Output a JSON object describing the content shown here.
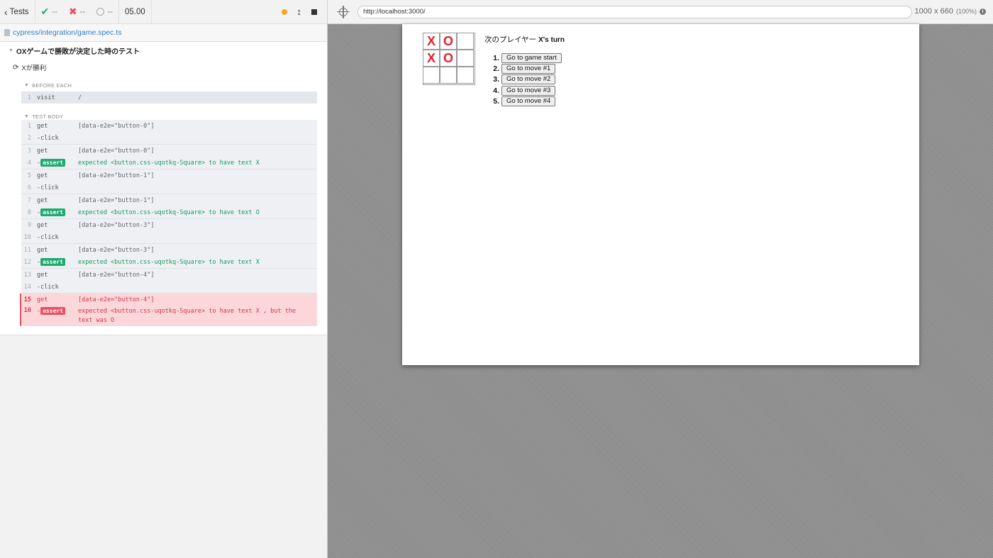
{
  "reporter": {
    "back_label": "Tests",
    "passed": "--",
    "failed": "--",
    "pending": "--",
    "duration": "05.00",
    "spec_path": "cypress/integration/game.spec.ts",
    "suite_title": "OXゲームで勝敗が決定した時のテスト",
    "test_title": "Xが勝利",
    "before_each_label": "BEFORE EACH",
    "test_body_label": "TEST BODY",
    "visit": {
      "num": "1",
      "name": "visit",
      "msg": "/"
    },
    "commands": [
      {
        "num": "1",
        "name": "get",
        "msg": "[data-e2e=\"button-0\"]"
      },
      {
        "num": "2",
        "name": "-click",
        "msg": ""
      },
      {
        "num": "3",
        "name": "get",
        "msg": "[data-e2e=\"button-0\"]"
      },
      {
        "num": "4",
        "name": "assert",
        "msg": "expected  <button.css-uqotkq-Square>  to have text  X"
      },
      {
        "num": "5",
        "name": "get",
        "msg": "[data-e2e=\"button-1\"]"
      },
      {
        "num": "6",
        "name": "-click",
        "msg": ""
      },
      {
        "num": "7",
        "name": "get",
        "msg": "[data-e2e=\"button-1\"]"
      },
      {
        "num": "8",
        "name": "assert",
        "msg": "expected  <button.css-uqotkq-Square>  to have text  O"
      },
      {
        "num": "9",
        "name": "get",
        "msg": "[data-e2e=\"button-3\"]"
      },
      {
        "num": "10",
        "name": "-click",
        "msg": ""
      },
      {
        "num": "11",
        "name": "get",
        "msg": "[data-e2e=\"button-3\"]"
      },
      {
        "num": "12",
        "name": "assert",
        "msg": "expected  <button.css-uqotkq-Square>  to have text  X"
      },
      {
        "num": "13",
        "name": "get",
        "msg": "[data-e2e=\"button-4\"]"
      },
      {
        "num": "14",
        "name": "-click",
        "msg": ""
      }
    ],
    "failed_commands": [
      {
        "num": "15",
        "name": "get",
        "msg": "[data-e2e=\"button-4\"]"
      },
      {
        "num": "16",
        "name": "assert",
        "msg": "expected  <button.css-uqotkq-Square>  to have text  X , but the text was  O"
      }
    ],
    "assert_badge": "assert"
  },
  "aut": {
    "url": "http://localhost:3000/",
    "viewport": "1000 x 660",
    "viewport_pct": "(100%)"
  },
  "game": {
    "squares": [
      "X",
      "O",
      "",
      "X",
      "O",
      "",
      "",
      "",
      ""
    ],
    "status_prefix": "次のプレイヤー",
    "status_player": "X's turn",
    "moves": [
      {
        "idx": "1.",
        "label": "Go to game start"
      },
      {
        "idx": "2.",
        "label": "Go to move #1"
      },
      {
        "idx": "3.",
        "label": "Go to move #2"
      },
      {
        "idx": "4.",
        "label": "Go to move #3"
      },
      {
        "idx": "5.",
        "label": "Go to move #4"
      }
    ]
  },
  "colors": {
    "pass": "#1fa971",
    "fail": "#e94f5f",
    "running": "#f5a623",
    "mark": "#e8202a"
  }
}
